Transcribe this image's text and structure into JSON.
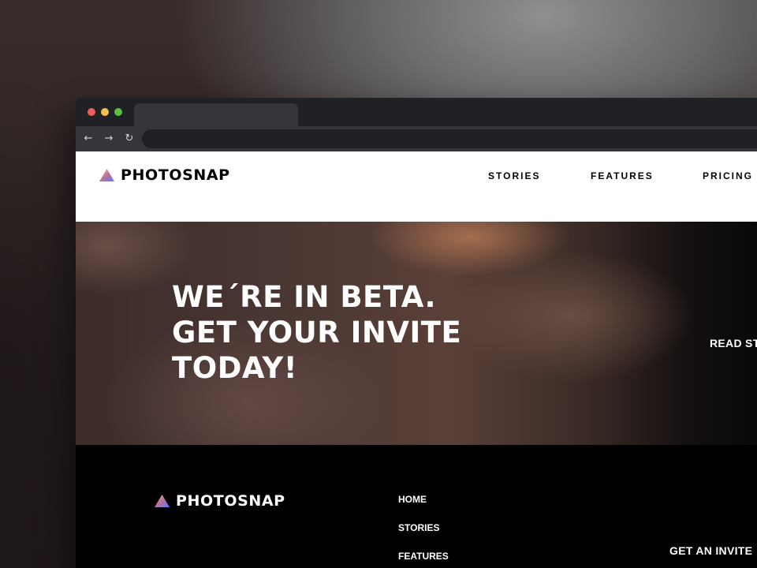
{
  "browser": {
    "window_controls": [
      "close",
      "minimize",
      "maximize"
    ],
    "nav_icons": {
      "back": "arrow-left-icon",
      "forward": "arrow-right-icon",
      "reload": "reload-icon"
    }
  },
  "header": {
    "logo": {
      "text": "PHOTOSNAP",
      "icon": "triangle-gradient-logo-icon"
    },
    "nav": [
      "STORIES",
      "FEATURES",
      "PRICING"
    ]
  },
  "hero": {
    "title_lines": [
      "WE´RE IN BETA.",
      "GET YOUR INVITE",
      "TODAY!"
    ],
    "link": "READ ST"
  },
  "footer": {
    "logo": {
      "text": "PHOTOSNAP",
      "icon": "triangle-gradient-logo-icon"
    },
    "nav": [
      "HOME",
      "STORIES",
      "FEATURES"
    ],
    "cta": "GET AN INVITE"
  },
  "colors": {
    "logo_gradient": [
      "#ffc593",
      "#bc7198",
      "#5a77ff"
    ],
    "text_dark": "#000000",
    "text_light": "#ffffff"
  }
}
